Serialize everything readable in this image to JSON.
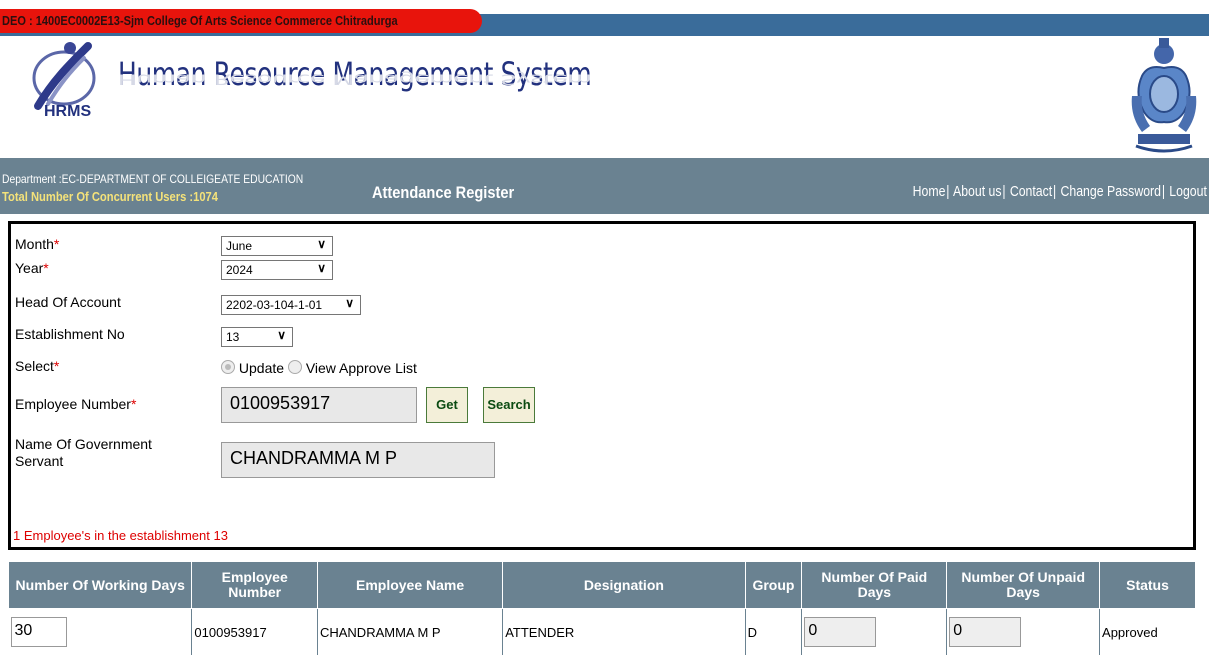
{
  "top_banner": {
    "deo": "DEO : 1400EC0002E13-Sjm College Of Arts Science Commerce Chitradurga"
  },
  "header": {
    "logo_text": "HRMS",
    "app_name": "Human Resource Management System",
    "emblem_icon": "karnataka-emblem-icon"
  },
  "info_bar": {
    "department": "Department :EC-DEPARTMENT OF COLLEIGEATE EDUCATION",
    "concurrent_users": "Total Number Of Concurrent Users :1074",
    "page_title": "Attendance Register",
    "nav": [
      "Home",
      "About us",
      "Contact",
      "Change Password",
      "Logout"
    ]
  },
  "form": {
    "month": {
      "label": "Month",
      "required": "*",
      "value": "June"
    },
    "year": {
      "label": "Year",
      "required": "*",
      "value": "2024"
    },
    "head_of_account": {
      "label": "Head Of Account",
      "value": "2202-03-104-1-01"
    },
    "establishment_no": {
      "label": "Establishment No",
      "value": "13"
    },
    "select": {
      "label": "Select",
      "required": "*",
      "options": [
        "Update",
        "View Approve List"
      ],
      "selected": "Update"
    },
    "employee_number": {
      "label": "Employee Number",
      "required": "*",
      "value": "0100953917"
    },
    "get_button": "Get",
    "search_button": "Search",
    "name": {
      "label_line1": "Name Of Government",
      "label_line2": "Servant",
      "value": "CHANDRAMMA M P"
    },
    "message": "1 Employee's in the establishment 13"
  },
  "table": {
    "headers": [
      "Number Of Working Days",
      "Employee Number",
      "Employee Name",
      "Designation",
      "Group",
      "Number Of Paid Days",
      "Number Of Unpaid Days",
      "Status"
    ],
    "rows": [
      {
        "working_days": "30",
        "employee_number": "0100953917",
        "employee_name": "CHANDRAMMA M P",
        "designation": "ATTENDER",
        "group": "D",
        "paid_days": "0",
        "unpaid_days": "0",
        "status": "Approved"
      }
    ]
  },
  "colors": {
    "banner": "#e8140c",
    "nav_bar": "#6a8291",
    "title_blue": "#22317e",
    "required": "#d00000",
    "button_text": "#0b4b12"
  }
}
